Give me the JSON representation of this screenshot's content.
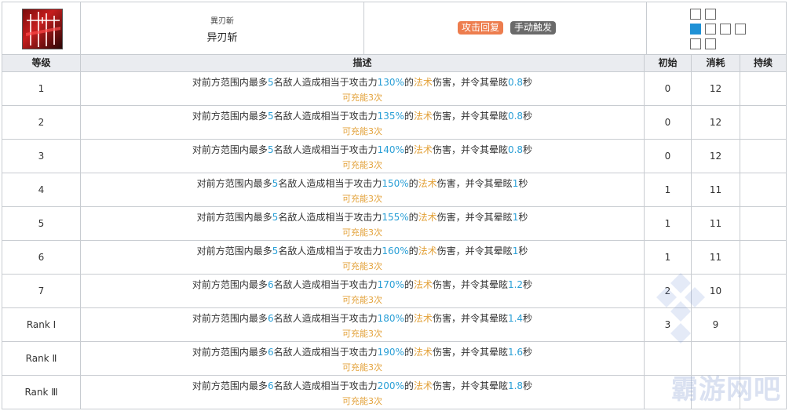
{
  "skill": {
    "name_sub": "異刃斬",
    "name": "异刃斩",
    "tags": [
      "攻击回复",
      "手动触发"
    ],
    "icon": "skill-icon-red-blades"
  },
  "columns": [
    "等级",
    "描述",
    "初始",
    "消耗",
    "持续"
  ],
  "rows": [
    {
      "level": "1",
      "desc": {
        "pre": "对前方范围内最多",
        "count": "5",
        "mid": "名敌人造成相当于攻击力",
        "pct": "130%",
        "mid2": "的",
        "type": "法术",
        "mid3": "伤害，并令其晕眩",
        "dur": "0.8",
        "post": "秒"
      },
      "charges": "可充能3次",
      "init": "0",
      "cost": "12",
      "duration": ""
    },
    {
      "level": "2",
      "desc": {
        "pre": "对前方范围内最多",
        "count": "5",
        "mid": "名敌人造成相当于攻击力",
        "pct": "135%",
        "mid2": "的",
        "type": "法术",
        "mid3": "伤害，并令其晕眩",
        "dur": "0.8",
        "post": "秒"
      },
      "charges": "可充能3次",
      "init": "0",
      "cost": "12",
      "duration": ""
    },
    {
      "level": "3",
      "desc": {
        "pre": "对前方范围内最多",
        "count": "5",
        "mid": "名敌人造成相当于攻击力",
        "pct": "140%",
        "mid2": "的",
        "type": "法术",
        "mid3": "伤害，并令其晕眩",
        "dur": "0.8",
        "post": "秒"
      },
      "charges": "可充能3次",
      "init": "0",
      "cost": "12",
      "duration": ""
    },
    {
      "level": "4",
      "desc": {
        "pre": "对前方范围内最多",
        "count": "5",
        "mid": "名敌人造成相当于攻击力",
        "pct": "150%",
        "mid2": "的",
        "type": "法术",
        "mid3": "伤害，并令其晕眩",
        "dur": "1",
        "post": "秒"
      },
      "charges": "可充能3次",
      "init": "1",
      "cost": "11",
      "duration": ""
    },
    {
      "level": "5",
      "desc": {
        "pre": "对前方范围内最多",
        "count": "5",
        "mid": "名敌人造成相当于攻击力",
        "pct": "155%",
        "mid2": "的",
        "type": "法术",
        "mid3": "伤害，并令其晕眩",
        "dur": "1",
        "post": "秒"
      },
      "charges": "可充能3次",
      "init": "1",
      "cost": "11",
      "duration": ""
    },
    {
      "level": "6",
      "desc": {
        "pre": "对前方范围内最多",
        "count": "5",
        "mid": "名敌人造成相当于攻击力",
        "pct": "160%",
        "mid2": "的",
        "type": "法术",
        "mid3": "伤害，并令其晕眩",
        "dur": "1",
        "post": "秒"
      },
      "charges": "可充能3次",
      "init": "1",
      "cost": "11",
      "duration": ""
    },
    {
      "level": "7",
      "desc": {
        "pre": "对前方范围内最多",
        "count": "6",
        "mid": "名敌人造成相当于攻击力",
        "pct": "170%",
        "mid2": "的",
        "type": "法术",
        "mid3": "伤害，并令其晕眩",
        "dur": "1.2",
        "post": "秒"
      },
      "charges": "可充能3次",
      "init": "2",
      "cost": "10",
      "duration": ""
    },
    {
      "level": "Rank Ⅰ",
      "desc": {
        "pre": "对前方范围内最多",
        "count": "6",
        "mid": "名敌人造成相当于攻击力",
        "pct": "180%",
        "mid2": "的",
        "type": "法术",
        "mid3": "伤害，并令其晕眩",
        "dur": "1.4",
        "post": "秒"
      },
      "charges": "可充能3次",
      "init": "3",
      "cost": "9",
      "duration": ""
    },
    {
      "level": "Rank Ⅱ",
      "desc": {
        "pre": "对前方范围内最多",
        "count": "6",
        "mid": "名敌人造成相当于攻击力",
        "pct": "190%",
        "mid2": "的",
        "type": "法术",
        "mid3": "伤害，并令其晕眩",
        "dur": "1.6",
        "post": "秒"
      },
      "charges": "可充能3次",
      "init": "",
      "cost": "",
      "duration": ""
    },
    {
      "level": "Rank Ⅲ",
      "desc": {
        "pre": "对前方范围内最多",
        "count": "6",
        "mid": "名敌人造成相当于攻击力",
        "pct": "200%",
        "mid2": "的",
        "type": "法术",
        "mid3": "伤害，并令其晕眩",
        "dur": "1.8",
        "post": "秒"
      },
      "charges": "可充能3次",
      "init": "",
      "cost": "",
      "duration": ""
    }
  ],
  "watermark": "霸游网吧",
  "colors": {
    "accent_blue": "#2a9fd6",
    "accent_orange": "#e3a23a",
    "tag_orange": "#ed7d4e",
    "tag_grey": "#6a6a6a",
    "range_active": "#1f91d6"
  }
}
